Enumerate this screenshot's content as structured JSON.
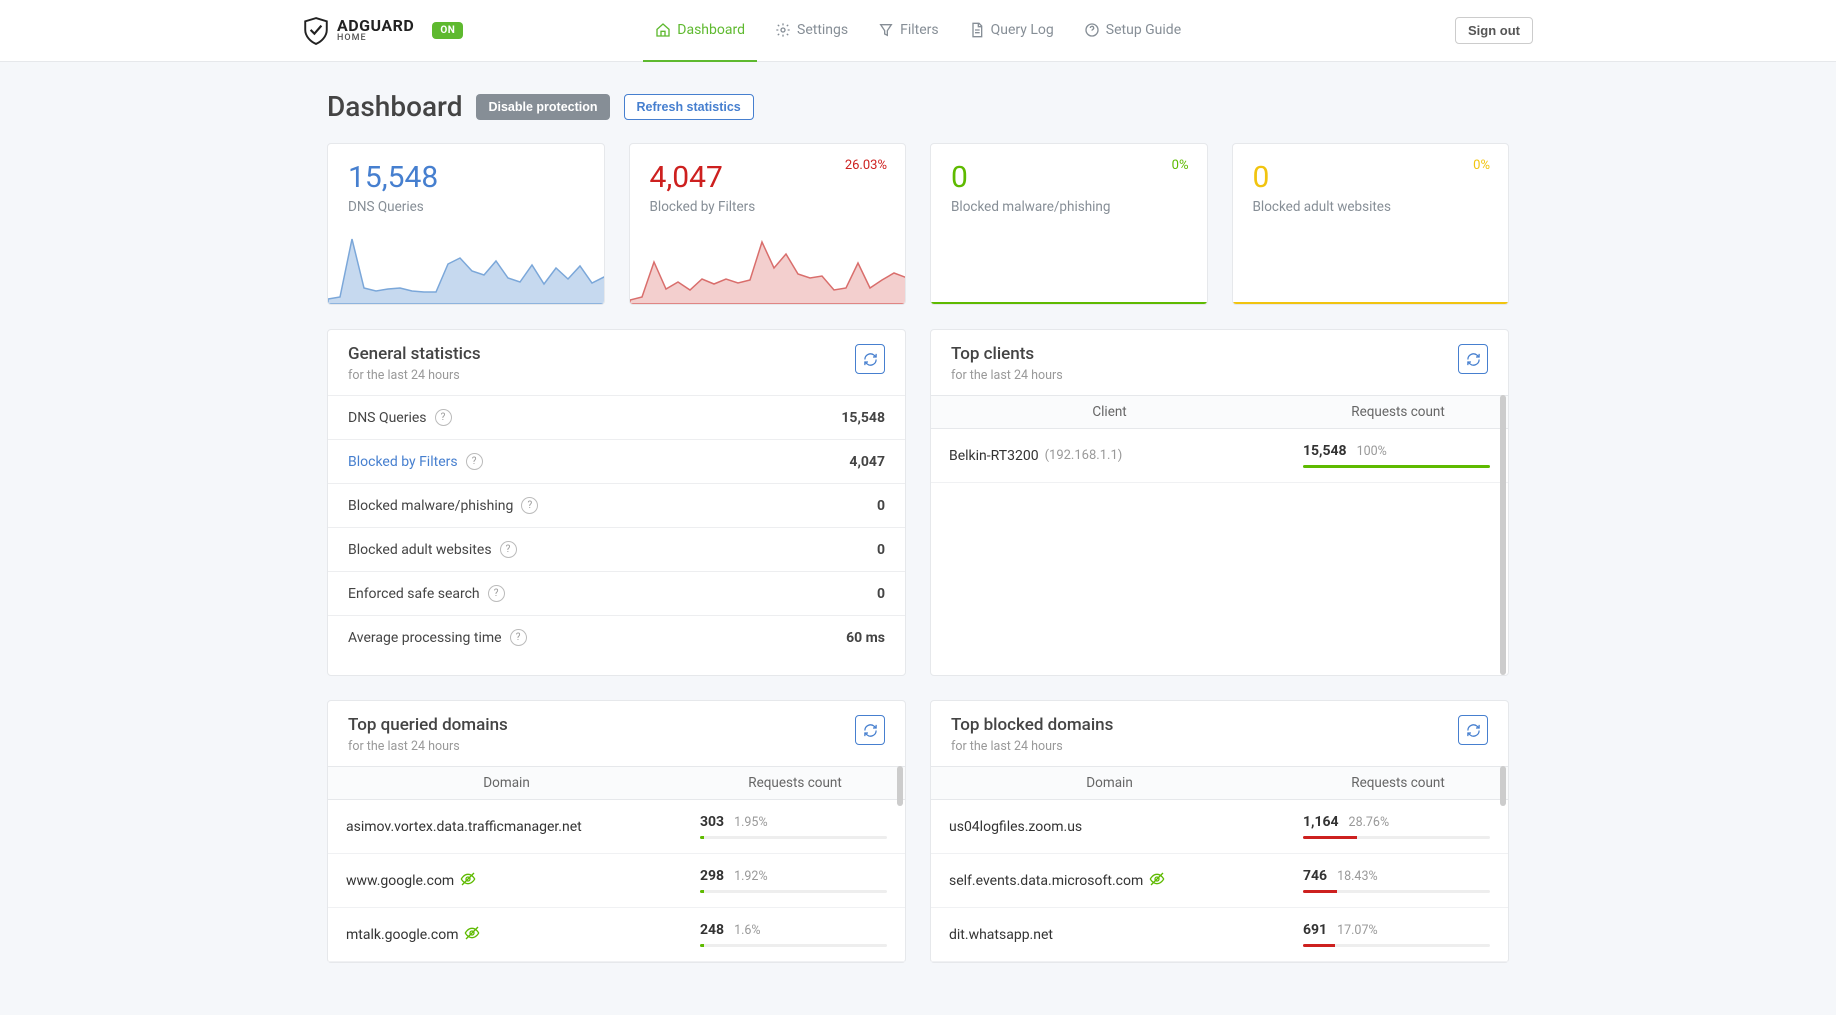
{
  "header": {
    "brand": "ADGUARD",
    "brand_sub": "HOME",
    "status_badge": "ON",
    "nav": [
      {
        "label": "Dashboard",
        "active": true
      },
      {
        "label": "Settings",
        "active": false
      },
      {
        "label": "Filters",
        "active": false
      },
      {
        "label": "Query Log",
        "active": false
      },
      {
        "label": "Setup Guide",
        "active": false
      }
    ],
    "signout": "Sign out"
  },
  "page": {
    "title": "Dashboard",
    "disable_btn": "Disable protection",
    "refresh_btn": "Refresh statistics"
  },
  "stats": [
    {
      "value": "15,548",
      "label": "DNS Queries",
      "pct": "",
      "color": "blue"
    },
    {
      "value": "4,047",
      "label": "Blocked by Filters",
      "pct": "26.03%",
      "color": "red"
    },
    {
      "value": "0",
      "label": "Blocked malware/phishing",
      "pct": "0%",
      "color": "green"
    },
    {
      "value": "0",
      "label": "Blocked adult websites",
      "pct": "0%",
      "color": "yellow"
    }
  ],
  "general": {
    "title": "General statistics",
    "sub": "for the last 24 hours",
    "rows": [
      {
        "label": "DNS Queries",
        "value": "15,548",
        "link": false
      },
      {
        "label": "Blocked by Filters",
        "value": "4,047",
        "link": true
      },
      {
        "label": "Blocked malware/phishing",
        "value": "0",
        "link": false
      },
      {
        "label": "Blocked adult websites",
        "value": "0",
        "link": false
      },
      {
        "label": "Enforced safe search",
        "value": "0",
        "link": false
      },
      {
        "label": "Average processing time",
        "value": "60 ms",
        "link": false
      }
    ]
  },
  "clients": {
    "title": "Top clients",
    "sub": "for the last 24 hours",
    "col1": "Client",
    "col2": "Requests count",
    "rows": [
      {
        "name": "Belkin-RT3200",
        "ip": "(192.168.1.1)",
        "count": "15,548",
        "pct": "100%",
        "barPct": 100,
        "barColor": "#5eba00"
      }
    ]
  },
  "queried": {
    "title": "Top queried domains",
    "sub": "for the last 24 hours",
    "col1": "Domain",
    "col2": "Requests count",
    "rows": [
      {
        "domain": "asimov.vortex.data.trafficmanager.net",
        "count": "303",
        "pct": "1.95%",
        "barPct": 2,
        "tracker": false
      },
      {
        "domain": "www.google.com",
        "count": "298",
        "pct": "1.92%",
        "barPct": 2,
        "tracker": true
      },
      {
        "domain": "mtalk.google.com",
        "count": "248",
        "pct": "1.6%",
        "barPct": 2,
        "tracker": true
      }
    ]
  },
  "blocked": {
    "title": "Top blocked domains",
    "sub": "for the last 24 hours",
    "col1": "Domain",
    "col2": "Requests count",
    "rows": [
      {
        "domain": "us04logfiles.zoom.us",
        "count": "1,164",
        "pct": "28.76%",
        "barPct": 29,
        "tracker": false
      },
      {
        "domain": "self.events.data.microsoft.com",
        "count": "746",
        "pct": "18.43%",
        "barPct": 18,
        "tracker": true
      },
      {
        "domain": "dit.whatsapp.net",
        "count": "691",
        "pct": "17.07%",
        "barPct": 17,
        "tracker": false
      }
    ]
  },
  "chart_data": [
    {
      "type": "area",
      "title": "DNS Queries",
      "x": [
        0,
        1,
        2,
        3,
        4,
        5,
        6,
        7,
        8,
        9,
        10,
        11,
        12,
        13,
        14,
        15,
        16,
        17,
        18,
        19,
        20,
        21,
        22,
        23
      ],
      "values": [
        120,
        140,
        1450,
        330,
        260,
        300,
        320,
        260,
        240,
        230,
        900,
        1050,
        780,
        700,
        1000,
        650,
        580,
        920,
        540,
        860,
        620,
        900,
        560,
        700
      ],
      "ylim": [
        0,
        1600
      ]
    },
    {
      "type": "area",
      "title": "Blocked by Filters",
      "x": [
        0,
        1,
        2,
        3,
        4,
        5,
        6,
        7,
        8,
        9,
        10,
        11,
        12,
        13,
        14,
        15,
        16,
        17,
        18,
        19,
        20,
        21,
        22,
        23
      ],
      "values": [
        20,
        35,
        300,
        95,
        140,
        90,
        160,
        125,
        155,
        130,
        150,
        420,
        230,
        320,
        200,
        170,
        180,
        95,
        105,
        260,
        100,
        150,
        200,
        160
      ],
      "ylim": [
        0,
        450
      ]
    }
  ]
}
